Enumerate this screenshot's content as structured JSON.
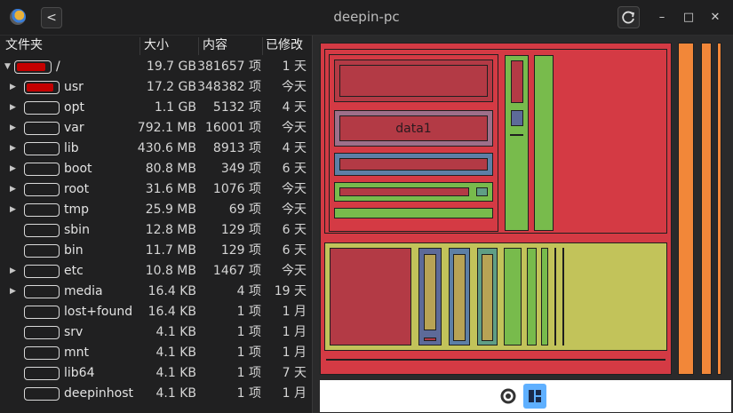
{
  "window": {
    "title": "deepin-pc",
    "back_glyph": "<",
    "refresh_glyph": "⟳",
    "minimize_glyph": "–",
    "maximize_glyph": "□",
    "close_glyph": "✕"
  },
  "table": {
    "headers": {
      "folder": "文件夹",
      "size": "大小",
      "contents": "内容",
      "modified": "已修改"
    },
    "rows": [
      {
        "name": "/",
        "size": "19.7 GB",
        "items": "381657 项",
        "modified": "1 天",
        "fill": 0.9,
        "expander": "down"
      },
      {
        "name": "usr",
        "size": "17.2 GB",
        "items": "348382 项",
        "modified": "今天",
        "fill": 0.87,
        "expander": "right"
      },
      {
        "name": "opt",
        "size": "1.1 GB",
        "items": "5132 项",
        "modified": "4 天",
        "fill": 0.0,
        "expander": "right"
      },
      {
        "name": "var",
        "size": "792.1 MB",
        "items": "16001 项",
        "modified": "今天",
        "fill": 0.0,
        "expander": "right"
      },
      {
        "name": "lib",
        "size": "430.6 MB",
        "items": "8913 项",
        "modified": "4 天",
        "fill": 0.0,
        "expander": "right"
      },
      {
        "name": "boot",
        "size": "80.8 MB",
        "items": "349 项",
        "modified": "6 天",
        "fill": 0.0,
        "expander": "right"
      },
      {
        "name": "root",
        "size": "31.6 MB",
        "items": "1076 项",
        "modified": "今天",
        "fill": 0.0,
        "expander": "right"
      },
      {
        "name": "tmp",
        "size": "25.9 MB",
        "items": "69 项",
        "modified": "今天",
        "fill": 0.0,
        "expander": "right"
      },
      {
        "name": "sbin",
        "size": "12.8 MB",
        "items": "129 项",
        "modified": "6 天",
        "fill": 0.0,
        "expander": ""
      },
      {
        "name": "bin",
        "size": "11.7 MB",
        "items": "129 项",
        "modified": "6 天",
        "fill": 0.0,
        "expander": ""
      },
      {
        "name": "etc",
        "size": "10.8 MB",
        "items": "1467 项",
        "modified": "今天",
        "fill": 0.0,
        "expander": "right"
      },
      {
        "name": "media",
        "size": "16.4 KB",
        "items": "4 项",
        "modified": "19 天",
        "fill": 0.0,
        "expander": "right"
      },
      {
        "name": "lost+found",
        "size": "16.4 KB",
        "items": "1 项",
        "modified": "1 月",
        "fill": 0.0,
        "expander": ""
      },
      {
        "name": "srv",
        "size": "4.1 KB",
        "items": "1 项",
        "modified": "1 月",
        "fill": 0.0,
        "expander": ""
      },
      {
        "name": "mnt",
        "size": "4.1 KB",
        "items": "1 项",
        "modified": "1 月",
        "fill": 0.0,
        "expander": ""
      },
      {
        "name": "lib64",
        "size": "4.1 KB",
        "items": "1 项",
        "modified": "7 天",
        "fill": 0.0,
        "expander": ""
      },
      {
        "name": "deepinhost",
        "size": "4.1 KB",
        "items": "1 项",
        "modified": "1 月",
        "fill": 0.0,
        "expander": ""
      }
    ]
  },
  "treemap": {
    "label": "data1"
  },
  "view_modes": {
    "rings_icon": "rings-chart-icon",
    "treemap_icon": "treemap-chart-icon",
    "active": "treemap"
  },
  "colors": {
    "usage_bar": "#c40000",
    "active_mode": "#5fb0ff"
  }
}
